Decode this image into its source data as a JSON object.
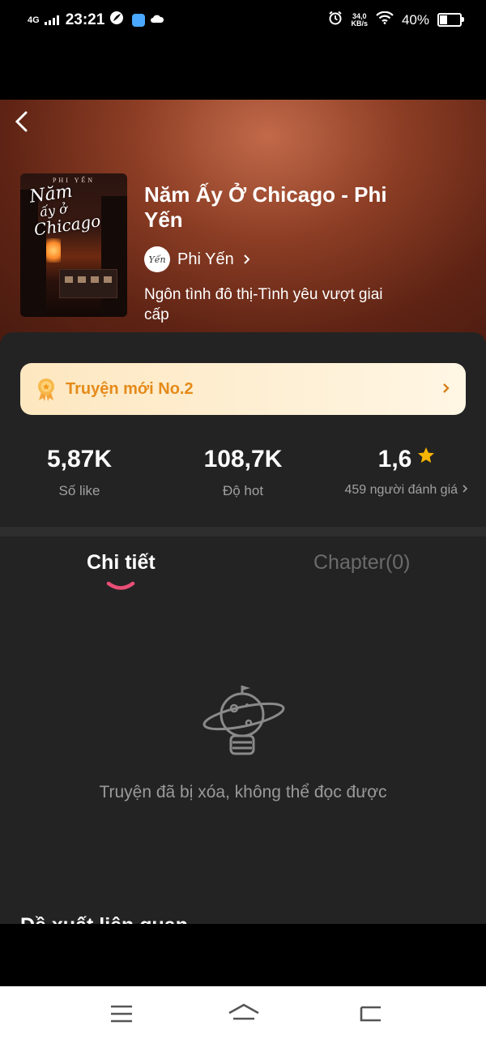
{
  "status_bar": {
    "network": "4G",
    "time": "23:21",
    "speed_value": "34,0",
    "speed_unit": "KB/s",
    "battery_percent": "40%",
    "battery_level": 0.4
  },
  "book": {
    "title": "Năm Ấy Ở Chicago - Phi Yến",
    "author": "Phi Yến",
    "genre": "Ngôn tình đô thị-Tình yêu vượt giai cấp",
    "cover_author": "PHI YẾN",
    "cover_title_line1": "Năm",
    "cover_title_line2": "ấy ở",
    "cover_title_line3": "Chicago",
    "author_avatar_text": "Yến"
  },
  "rank_banner": {
    "label": "Truyện mới No.2"
  },
  "stats": {
    "likes_value": "5,87K",
    "likes_label": "Số like",
    "hot_value": "108,7K",
    "hot_label": "Độ hot",
    "rating_value": "1,6",
    "rating_label": "459 người đánh giá"
  },
  "tabs": {
    "details": "Chi tiết",
    "chapters": "Chapter(0)"
  },
  "empty_state": {
    "message": "Truyện đã bị xóa, không thể đọc được"
  },
  "related": {
    "title": "Đề xuất liên quan"
  },
  "colors": {
    "accent_pink": "#e94e77",
    "rank_orange": "#e58a1a",
    "star_yellow": "#f5b400",
    "panel_bg": "#232323"
  }
}
